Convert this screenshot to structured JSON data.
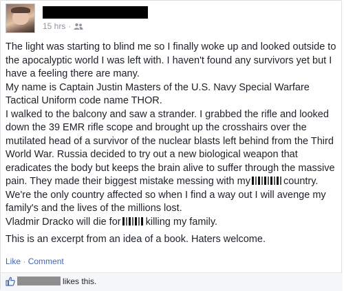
{
  "post": {
    "timestamp": "15 hrs",
    "separator": "·",
    "audience_icon": "friends-icon",
    "paragraphs": [
      "The light was starting to blind me so I finally woke up and looked outside to the apocalyptic world I was left with. I haven't found any survivors yet but I have a feeling there are many.",
      "My name is Captain Justin Masters of the U.S. Navy Special Warfare Tactical Uniform code name THOR.",
      "I walked to the balcony and saw a strander. I grabbed the rifle and looked down the 39 EMR rifle scope and brought up the crosshairs over the mutilated head of a survivor of the nuclear blasts left behind from the Third World War. Russia decided to try out a new biological weapon that eradicates the body but keeps the brain alive to suffer through the massive pain. They made their biggest mistake messing with my"
    ],
    "after_redact_1": "country. We're the only country affected so when I find a way out I will avenge my family's and the lives of the millions lost.",
    "line_dracko_before": "Vladmir Dracko will die for",
    "line_dracko_after": "killing my family.",
    "excerpt": "This is an excerpt from an idea of a book. Haters welcome."
  },
  "actions": {
    "like": "Like",
    "separator": "·",
    "comment": "Comment"
  },
  "likes": {
    "icon": "thumbs-up-icon",
    "suffix": "likes this."
  },
  "colors": {
    "link": "#4267b2",
    "meta": "#90949c",
    "text": "#1d2129",
    "likes_bg": "#f6f7f9"
  }
}
